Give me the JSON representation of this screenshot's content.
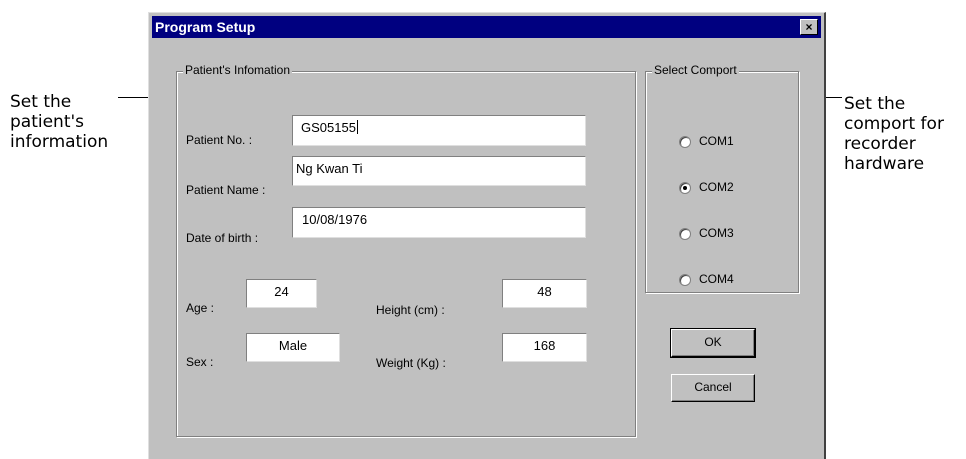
{
  "annotations": {
    "left": "Set the\npatient's\ninformation",
    "right": "Set the\ncomport for\nrecorder\nhardware"
  },
  "dialog": {
    "title": "Program Setup",
    "close_label": "×",
    "patient_group": {
      "legend": "Patient's Infomation",
      "patient_no_label": "Patient No. :",
      "patient_no_value": "GS05155",
      "patient_name_label": "Patient Name :",
      "patient_name_value": "Ng Kwan Ti",
      "dob_label": "Date of birth :",
      "dob_value": "10/08/1976",
      "age_label": "Age :",
      "age_value": "24",
      "height_label": "Height (cm) :",
      "height_value": "48",
      "sex_label": "Sex :",
      "sex_value": "Male",
      "weight_label": "Weight (Kg) :",
      "weight_value": "168"
    },
    "comport_group": {
      "legend": "Select Comport",
      "options": [
        "COM1",
        "COM2",
        "COM3",
        "COM4"
      ],
      "selected": "COM2"
    },
    "buttons": {
      "ok": "OK",
      "cancel": "Cancel"
    }
  }
}
